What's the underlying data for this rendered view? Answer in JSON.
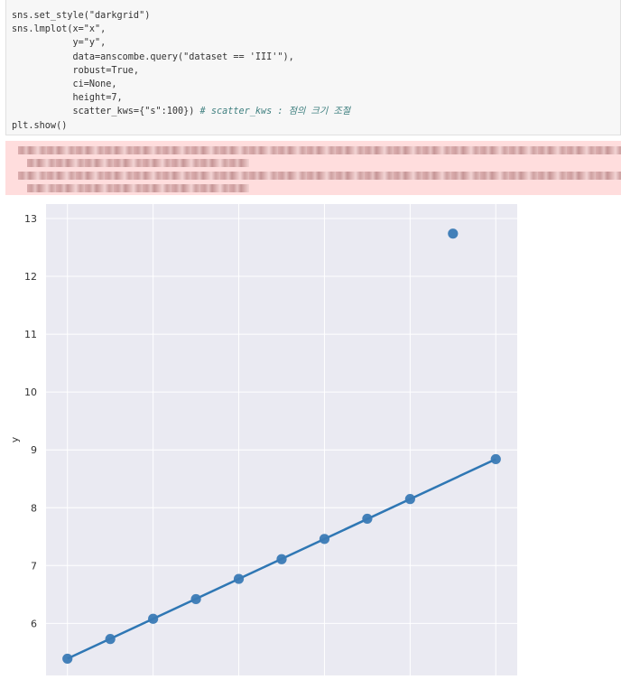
{
  "code": {
    "line1": "sns.set_style(\"darkgrid\")",
    "line2": "sns.lmplot(x=\"x\",",
    "line3": "y=\"y\",",
    "line4": "data=anscombe.query(\"dataset == 'III'\"),",
    "line5": "robust=True,",
    "line6": "ci=None,",
    "line7": "height=7,",
    "line8_code": "scatter_kws={\"s\":100})",
    "line8_comment": "# scatter_kws : 점의 크기 조절",
    "line9": "plt.show()"
  },
  "chart_data": {
    "type": "scatter",
    "xlabel": "",
    "ylabel": "y",
    "ylim": [
      5.1,
      13.25
    ],
    "xlim": [
      3.5,
      14.5
    ],
    "yticks": [
      6,
      7,
      8,
      9,
      10,
      11,
      12,
      13
    ],
    "grid": true,
    "series": [
      {
        "kind": "points",
        "color": "#3a7ab5",
        "x": [
          4,
          5,
          6,
          7,
          8,
          9,
          10,
          11,
          12,
          13,
          14
        ],
        "y": [
          5.39,
          5.73,
          6.08,
          6.42,
          6.77,
          7.11,
          7.46,
          7.81,
          8.15,
          12.74,
          8.84
        ]
      },
      {
        "kind": "regression-line",
        "color": "#2f77b4",
        "x": [
          4,
          14
        ],
        "y": [
          5.39,
          8.84
        ]
      }
    ],
    "background": "#eaeaf2"
  }
}
